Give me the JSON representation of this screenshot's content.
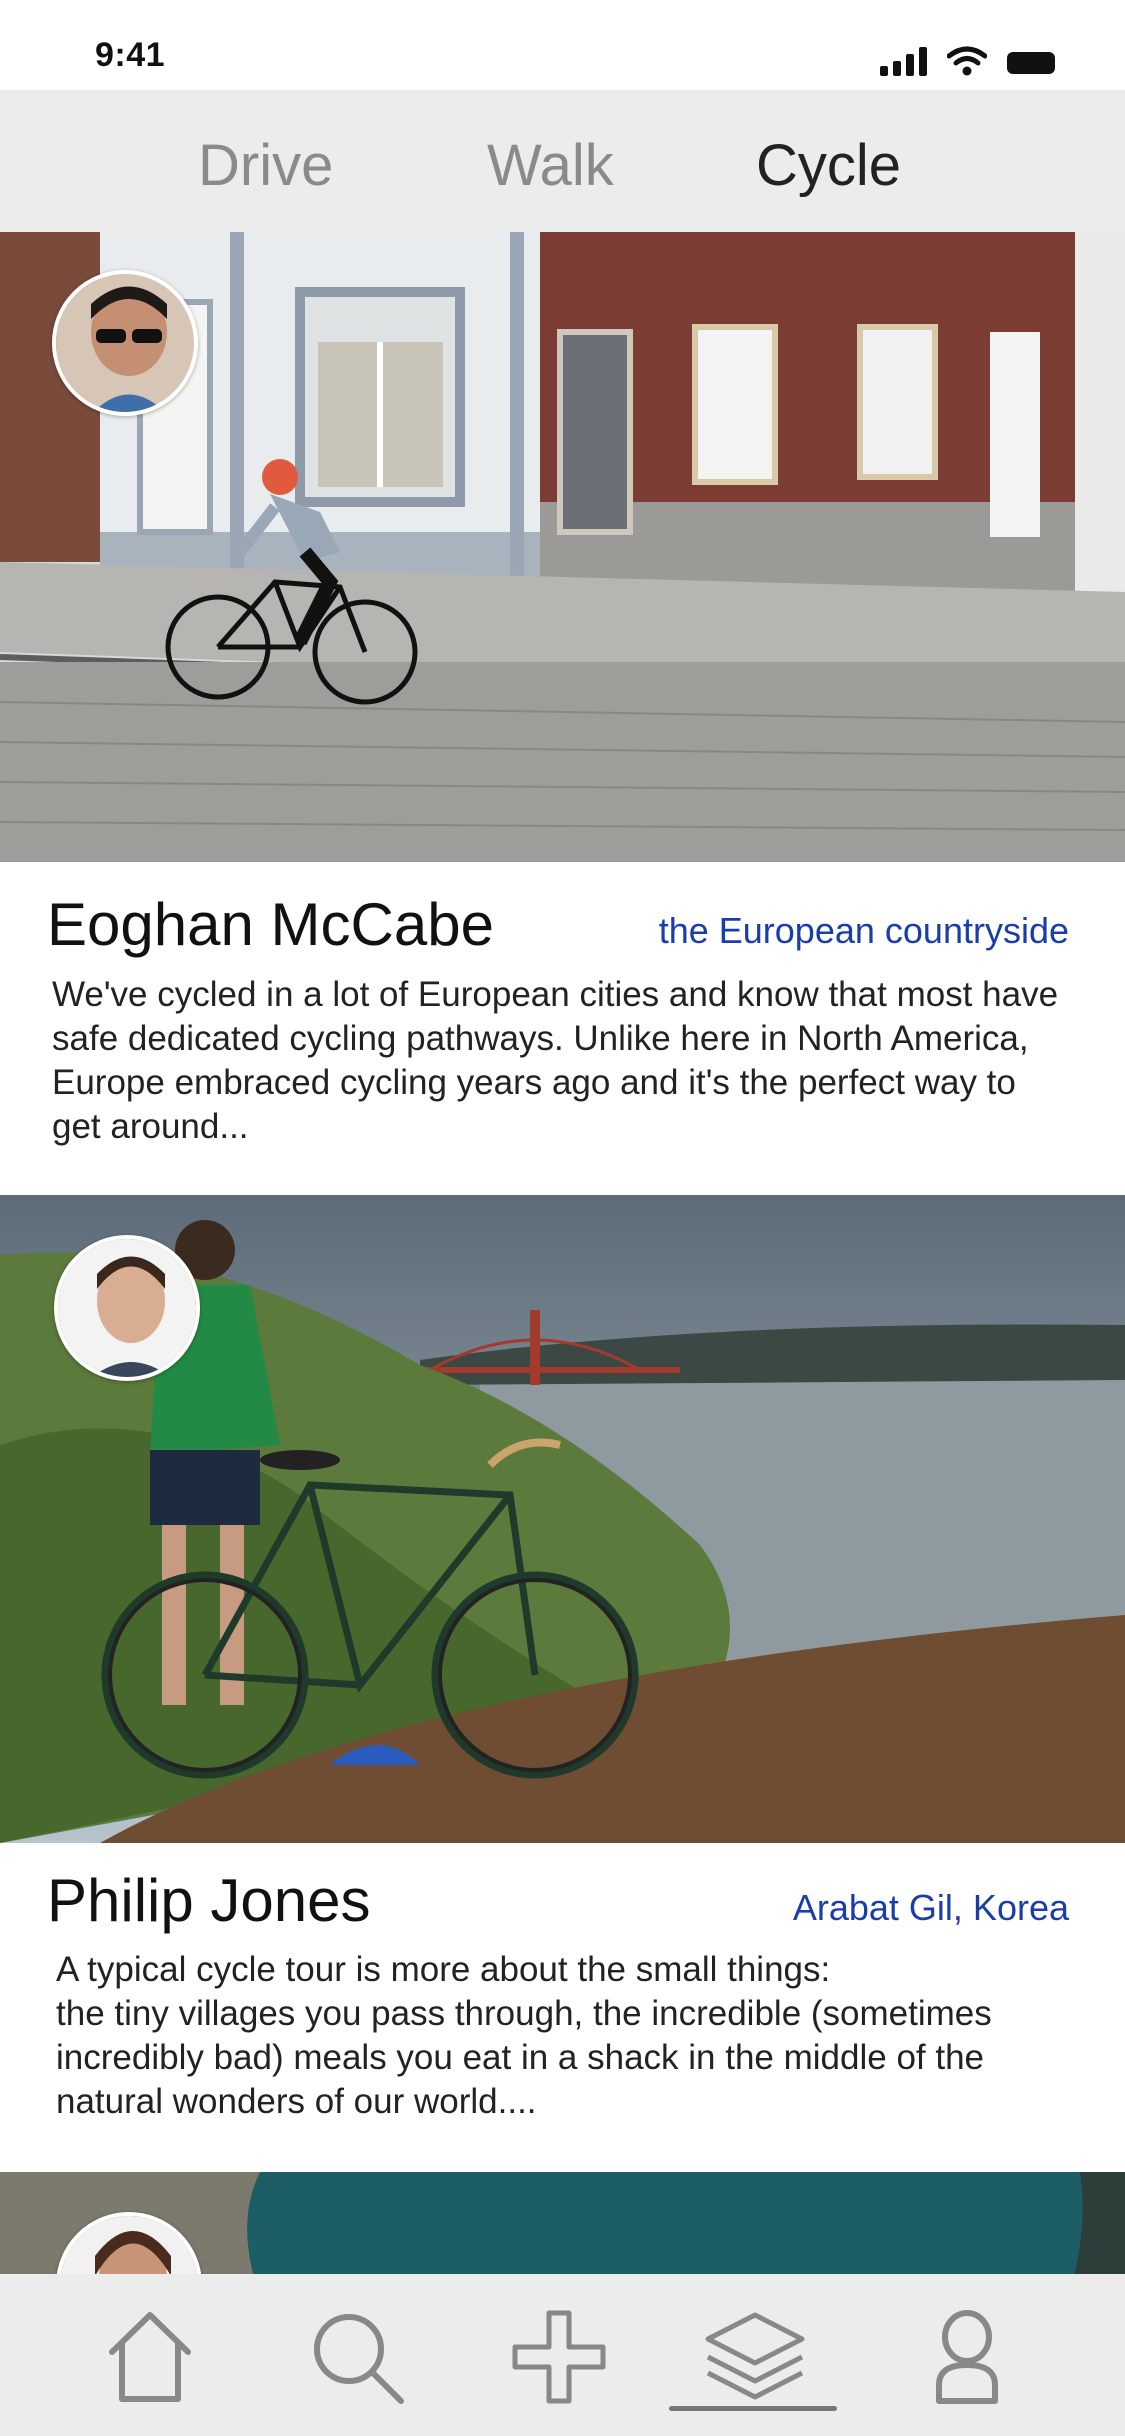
{
  "status_bar": {
    "time": "9:41"
  },
  "tabs": [
    {
      "label": "Drive",
      "active": false
    },
    {
      "label": "Walk",
      "active": false
    },
    {
      "label": "Cycle",
      "active": true
    }
  ],
  "posts": [
    {
      "author": "Eoghan McCabe",
      "location": "the European countryside",
      "excerpt": "We've cycled in a lot of European cities and know that most have\nsafe dedicated cycling pathways. Unlike here in North America,\nEurope embraced cycling years ago and it's the perfect way to\nget around..."
    },
    {
      "author": "Philip Jones",
      "location": "Arabat Gil, Korea",
      "excerpt": "A typical cycle tour is more about the small things:\nthe tiny villages you pass through, the incredible (sometimes\nincredibly bad) meals you eat in a shack in the middle of the\nnatural wonders of our world...."
    }
  ],
  "bottom_nav": [
    {
      "icon": "home-icon"
    },
    {
      "icon": "search-icon"
    },
    {
      "icon": "plus-icon"
    },
    {
      "icon": "layers-icon",
      "active": true
    },
    {
      "icon": "profile-icon"
    }
  ],
  "colors": {
    "accent_link": "#1a3ea8",
    "tabbar_bg": "#ececec",
    "inactive_tab": "#8a8a8a"
  }
}
